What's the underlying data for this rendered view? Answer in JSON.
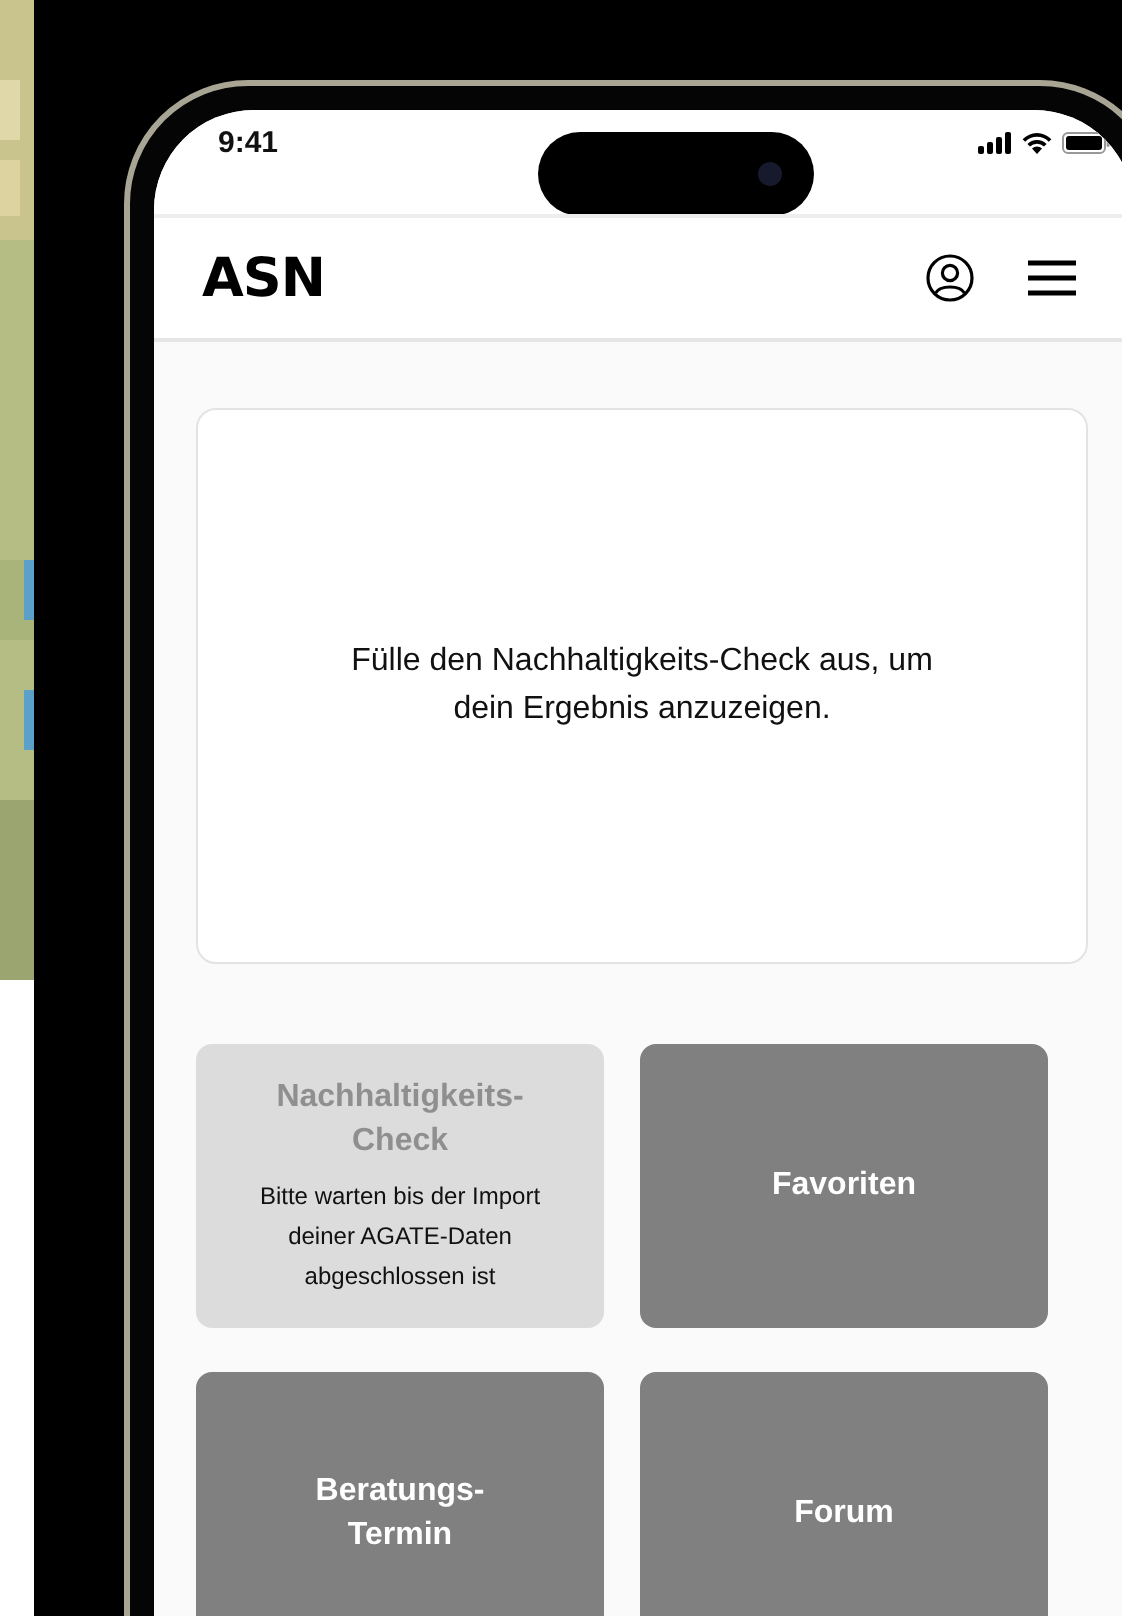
{
  "status_bar": {
    "time": "9:41"
  },
  "header": {
    "logo": "ASN"
  },
  "result_card": {
    "message": "Fülle den Nachhaltigkeits-Check aus, um dein Ergebnis anzuzeigen."
  },
  "tiles": [
    {
      "title": "Nachhaltigkeits-Check",
      "subtitle": "Bitte warten bis der Import deiner AGATE-Daten abgeschlossen ist",
      "disabled": true
    },
    {
      "title": "Favoriten",
      "disabled": false
    },
    {
      "title": "Beratungs-Termin",
      "disabled": false
    },
    {
      "title": "Forum",
      "disabled": false
    }
  ]
}
